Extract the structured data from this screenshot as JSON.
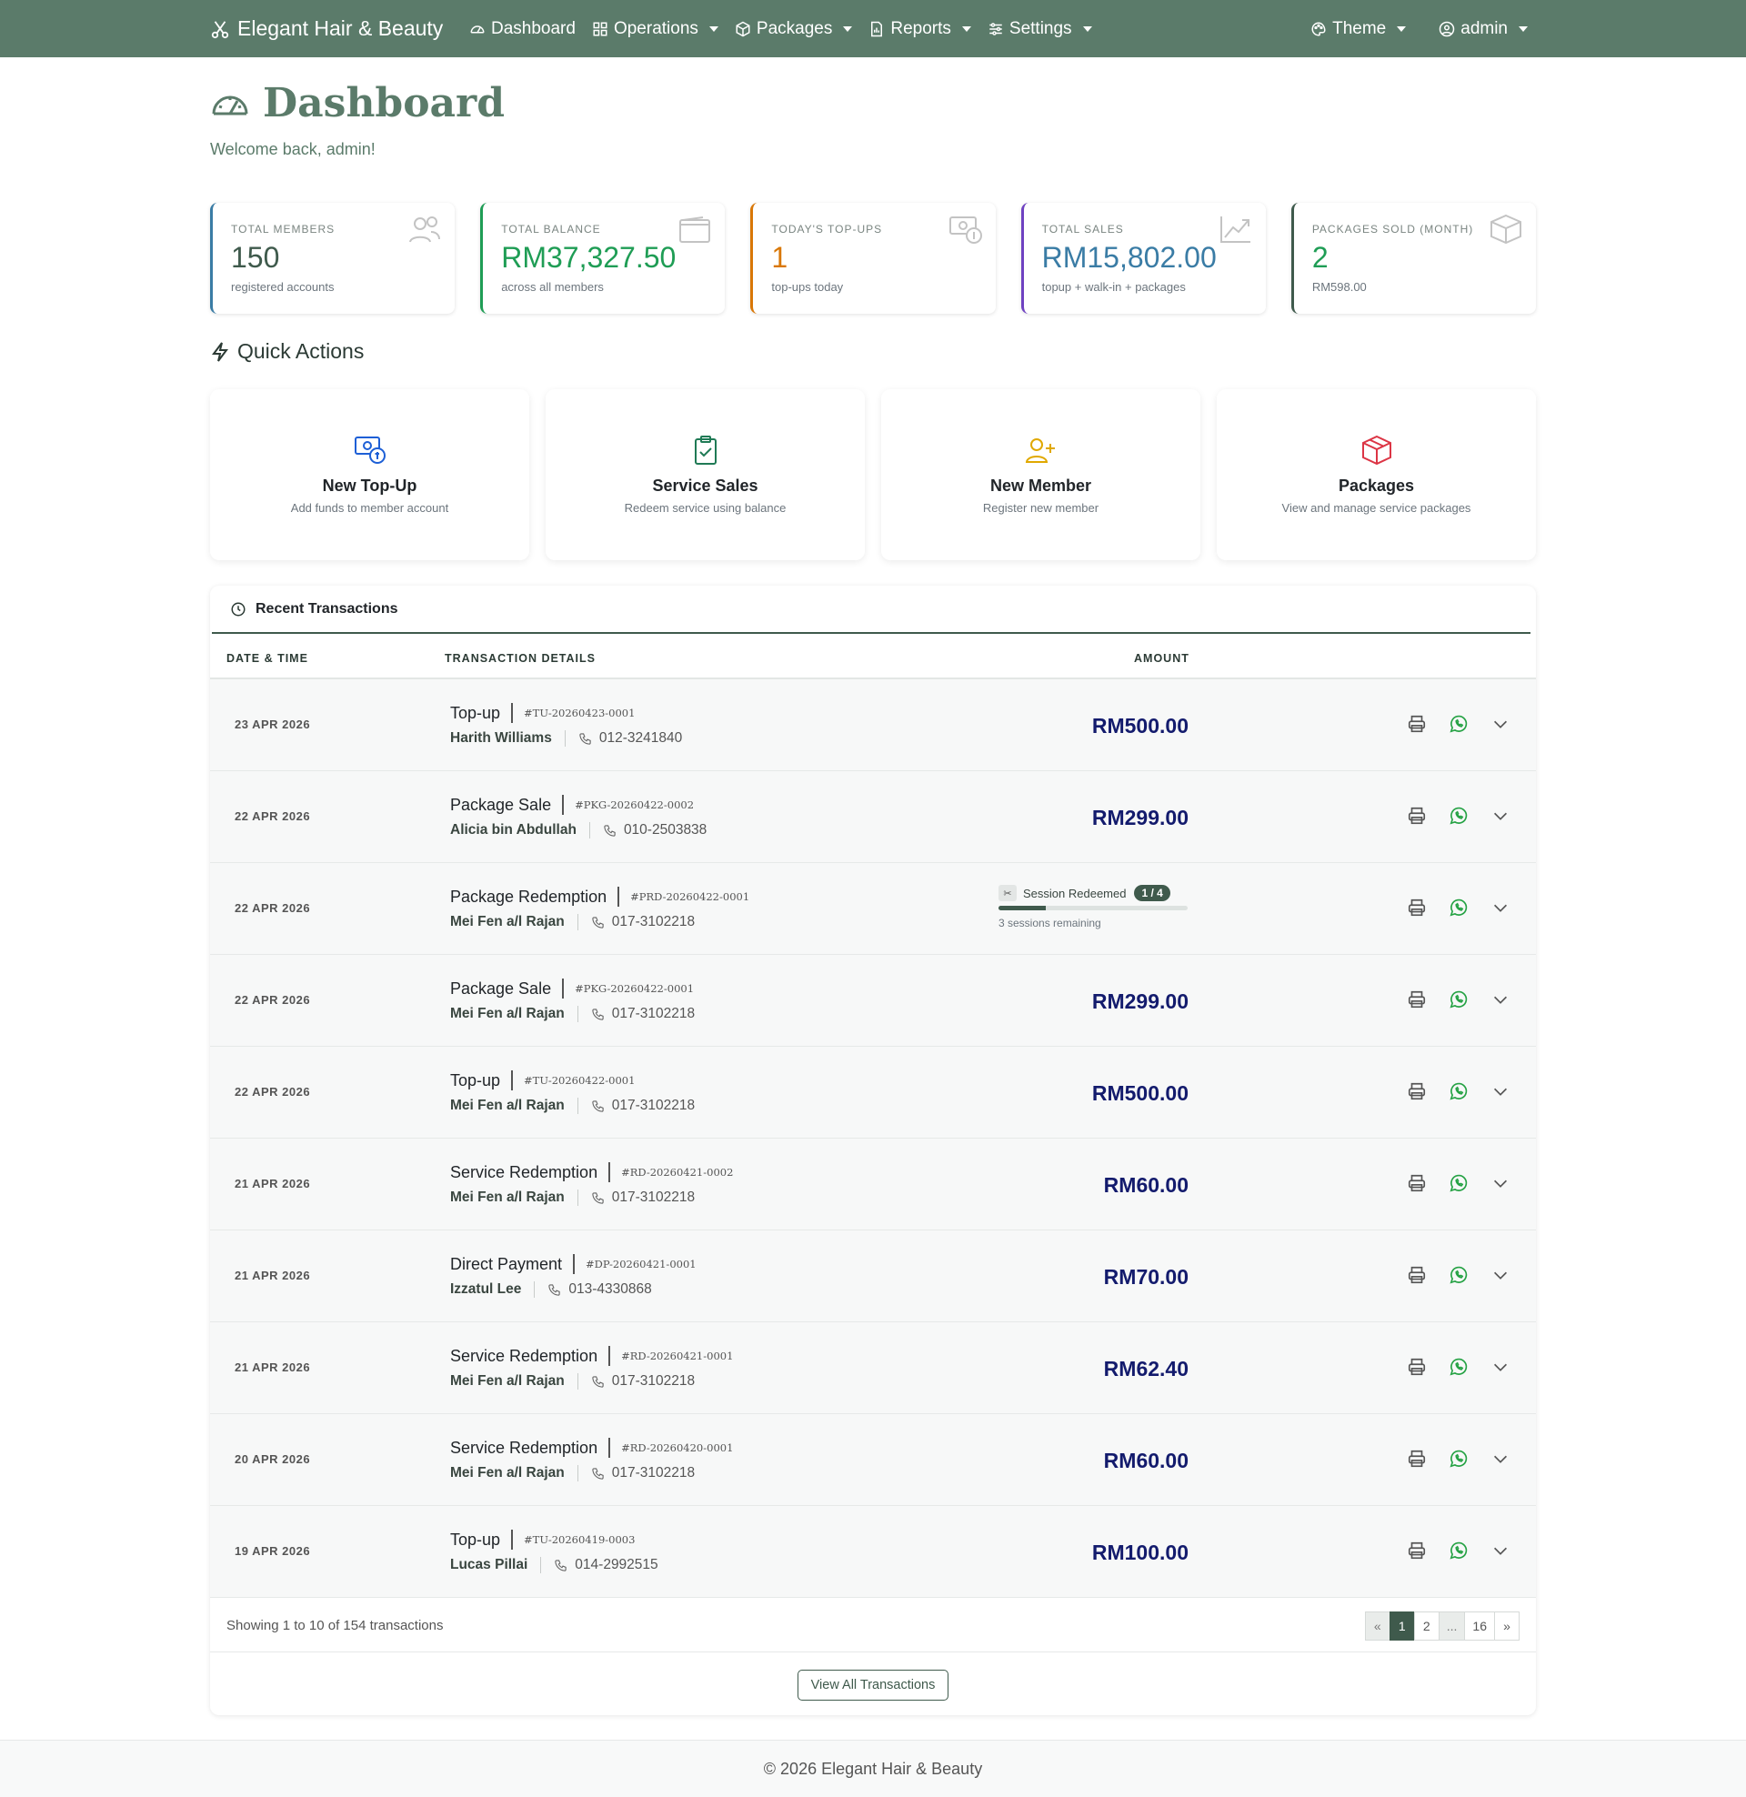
{
  "nav": {
    "brand": "Elegant Hair & Beauty",
    "items": [
      {
        "label": "Dashboard",
        "icon": "speedometer-icon",
        "dropdown": false
      },
      {
        "label": "Operations",
        "icon": "grid-icon",
        "dropdown": true
      },
      {
        "label": "Packages",
        "icon": "box-icon",
        "dropdown": true
      },
      {
        "label": "Reports",
        "icon": "report-icon",
        "dropdown": true
      },
      {
        "label": "Settings",
        "icon": "sliders-icon",
        "dropdown": true
      }
    ],
    "theme_label": "Theme",
    "user_label": "admin"
  },
  "header": {
    "title": "Dashboard",
    "welcome": "Welcome back, admin!"
  },
  "stats": [
    {
      "label": "Total Members",
      "value": "150",
      "sub": "registered accounts",
      "color": "#3a7ca5"
    },
    {
      "label": "Total Balance",
      "value": "RM37,327.50",
      "sub": "across all members",
      "color": "#1f9d55"
    },
    {
      "label": "Today's Top-Ups",
      "value": "1",
      "sub": "top-ups today",
      "color": "#d97706"
    },
    {
      "label": "Total Sales",
      "value": "RM15,802.00",
      "sub": "topup + walk-in + packages",
      "color": "#3a7ca5"
    },
    {
      "label": "Packages Sold (Month)",
      "value": "2",
      "sub": "RM598.00",
      "color": "#1f9d55"
    }
  ],
  "quick_actions": {
    "title": "Quick Actions",
    "items": [
      {
        "name": "New Top-Up",
        "desc": "Add funds to member account"
      },
      {
        "name": "Service Sales",
        "desc": "Redeem service using balance"
      },
      {
        "name": "New Member",
        "desc": "Register new member"
      },
      {
        "name": "Packages",
        "desc": "View and manage service packages"
      }
    ]
  },
  "transactions": {
    "title": "Recent Transactions",
    "columns": {
      "date": "DATE & TIME",
      "details": "TRANSACTION DETAILS",
      "amount": "AMOUNT"
    },
    "rows": [
      {
        "date": "23 APR 2026",
        "type": "Top-up",
        "ref": "#TU-20260423-0001",
        "name": "Harith Williams",
        "phone": "012-3241840",
        "amount": "RM500.00"
      },
      {
        "date": "22 APR 2026",
        "type": "Package Sale",
        "ref": "#PKG-20260422-0002",
        "name": "Alicia bin Abdullah",
        "phone": "010-2503838",
        "amount": "RM299.00"
      },
      {
        "date": "22 APR 2026",
        "type": "Package Redemption",
        "ref": "#PRD-20260422-0001",
        "name": "Mei Fen a/l Rajan",
        "phone": "017-3102218",
        "amount": "",
        "session": {
          "label": "Session Redeemed",
          "badge": "1 / 4",
          "used": 1,
          "total": 4,
          "remaining": "3 sessions remaining"
        }
      },
      {
        "date": "22 APR 2026",
        "type": "Package Sale",
        "ref": "#PKG-20260422-0001",
        "name": "Mei Fen a/l Rajan",
        "phone": "017-3102218",
        "amount": "RM299.00"
      },
      {
        "date": "22 APR 2026",
        "type": "Top-up",
        "ref": "#TU-20260422-0001",
        "name": "Mei Fen a/l Rajan",
        "phone": "017-3102218",
        "amount": "RM500.00"
      },
      {
        "date": "21 APR 2026",
        "type": "Service Redemption",
        "ref": "#RD-20260421-0002",
        "name": "Mei Fen a/l Rajan",
        "phone": "017-3102218",
        "amount": "RM60.00"
      },
      {
        "date": "21 APR 2026",
        "type": "Direct Payment",
        "ref": "#DP-20260421-0001",
        "name": "Izzatul Lee",
        "phone": "013-4330868",
        "amount": "RM70.00"
      },
      {
        "date": "21 APR 2026",
        "type": "Service Redemption",
        "ref": "#RD-20260421-0001",
        "name": "Mei Fen a/l Rajan",
        "phone": "017-3102218",
        "amount": "RM62.40"
      },
      {
        "date": "20 APR 2026",
        "type": "Service Redemption",
        "ref": "#RD-20260420-0001",
        "name": "Mei Fen a/l Rajan",
        "phone": "017-3102218",
        "amount": "RM60.00"
      },
      {
        "date": "19 APR 2026",
        "type": "Top-up",
        "ref": "#TU-20260419-0003",
        "name": "Lucas Pillai",
        "phone": "014-2992515",
        "amount": "RM100.00"
      }
    ],
    "showing": "Showing 1 to 10 of 154 transactions",
    "pagination": [
      "«",
      "1",
      "2",
      "...",
      "16",
      "»"
    ],
    "current_page": "1",
    "view_all": "View All Transactions"
  },
  "footer": "© 2026 Elegant Hair & Beauty"
}
